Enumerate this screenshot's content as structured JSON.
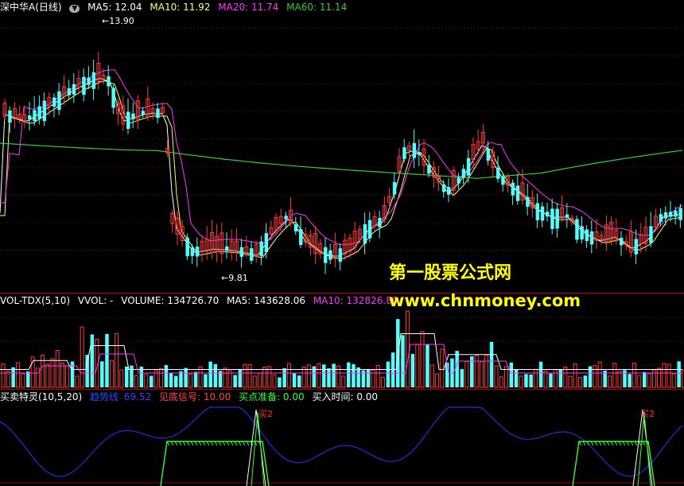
{
  "colors": {
    "up": "#ff3b3b",
    "down": "#54fcfc",
    "ma5": "#ffffff",
    "ma10": "#ffff66",
    "ma20": "#ff33ff",
    "ma60": "#33cc33",
    "grid": "#8b0000",
    "blueline": "#1f2fd6",
    "green": "#33ff33"
  },
  "price_panel": {
    "title": "深中华A(日线)",
    "ma5": "MA5: 12.04",
    "ma10": "MA10: 11.92",
    "ma20": "MA20: 11.74",
    "ma60": "MA60: 11.14",
    "high_label": "13.90",
    "low_label": "9.81"
  },
  "volume_panel": {
    "title": "VOL-TDX(5,10)",
    "vvol": "VVOL: -",
    "volume": "VOLUME: 134726.70",
    "ma5": "MA5: 143628.06",
    "ma10": "MA10: 132826.80"
  },
  "indicator_panel": {
    "title": "买卖特灵(10,5,20)",
    "trend": "趋势线",
    "trend_value": "69.52",
    "bottom_signal": "见底信号: 10.00",
    "buy_ready": "买点准备: 0.00",
    "buy_time": "买入时间: 0.00",
    "buy_mark": "买2"
  },
  "watermark": {
    "line1": "第一股票公式网",
    "line2": "www.chnmoney.com"
  }
}
